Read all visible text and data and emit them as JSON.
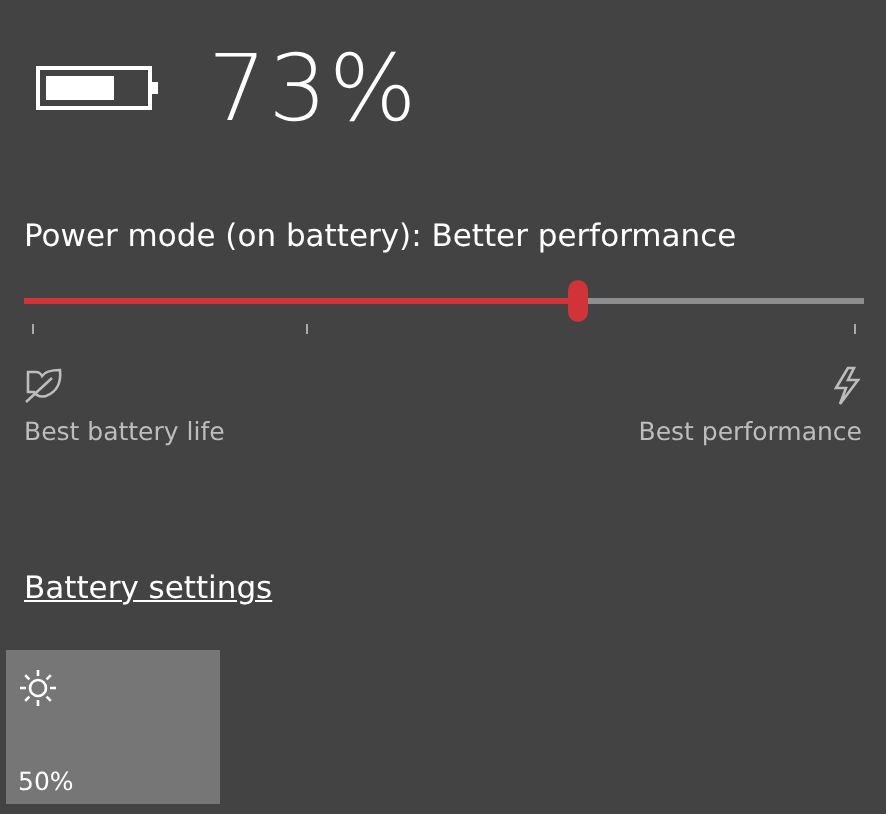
{
  "battery": {
    "percent": "73%"
  },
  "power_mode": {
    "label": "Power mode (on battery): Better performance",
    "level": 0.66,
    "min_label": "Best battery life",
    "max_label": "Best performance"
  },
  "link": "Battery settings",
  "quick_actions": [
    {
      "kind": "brightness",
      "label": "50%"
    }
  ]
}
